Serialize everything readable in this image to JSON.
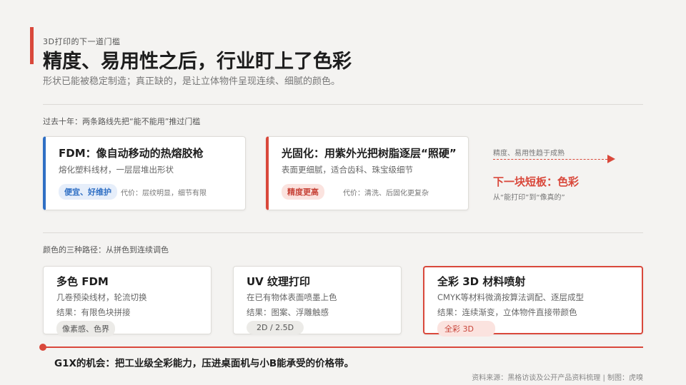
{
  "header": {
    "kicker": "3D打印的下一道门槛",
    "title": "精度、易用性之后，行业盯上了色彩",
    "subtitle": "形状已能被稳定制造；真正缺的，是让立体物件呈现连续、细腻的颜色。"
  },
  "section1": {
    "label": "过去十年：两条路线先把“能不能用”推过门槛",
    "cards": [
      {
        "title": "FDM：像自动移动的热熔胶枪",
        "desc": "熔化塑料线材，一层层堆出形状",
        "tag": "便宜、好维护",
        "cost": "代价：层纹明显，细节有限"
      },
      {
        "title": "光固化：用紫外光把树脂逐层“照硬”",
        "desc": "表面更细腻，适合齿科、珠宝级细节",
        "tag": "精度更高",
        "cost": "代价：清洗、后固化更复杂"
      }
    ],
    "side": {
      "note": "精度、易用性趋于成熟",
      "headline": "下一块短板：色彩",
      "sub": "从“能打印”到“像真的”"
    }
  },
  "section2": {
    "label": "颜色的三种路径：从拼色到连续调色",
    "cards": [
      {
        "title": "多色 FDM",
        "desc": "几卷预染线材，轮流切换",
        "result": "结果：有限色块拼接",
        "tag": "像素感、色界"
      },
      {
        "title": "UV 纹理打印",
        "desc": "在已有物体表面喷墨上色",
        "result": "结果：图案、浮雕触感",
        "tag": "2D / 2.5D"
      },
      {
        "title": "全彩 3D 材料喷射",
        "desc": "CMYK等材料微滴按算法调配、逐层成型",
        "result": "结果：连续渐变，立体物件直接带颜色",
        "tag": "全彩 3D"
      }
    ]
  },
  "takeaway": "G1X的机会：把工业级全彩能力，压进桌面机与小B能承受的价格带。",
  "footer": "资料来源：黑格访谈及公开产品资料梳理  |  制图：虎嗅",
  "colors": {
    "accent": "#d9483b",
    "blue": "#2f6fc4",
    "background": "#f4f3f1"
  }
}
